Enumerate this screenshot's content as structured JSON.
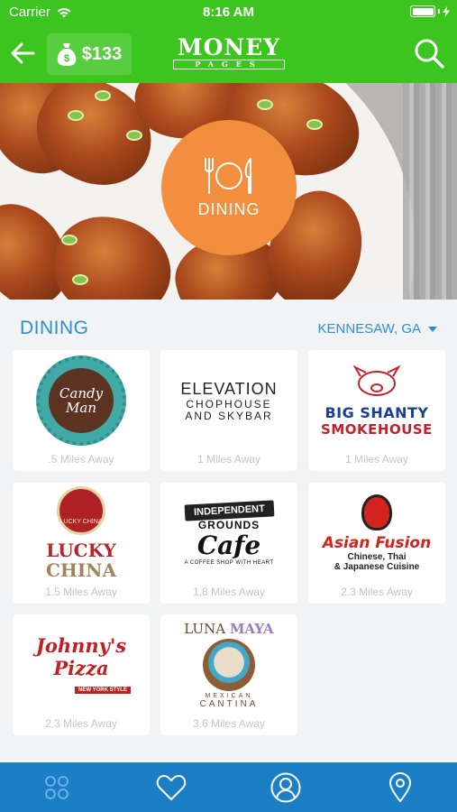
{
  "status_bar": {
    "carrier": "Carrier",
    "time": "8:16 AM",
    "battery_level": 1.0
  },
  "header": {
    "balance": "$133",
    "logo_line1": "MONEY",
    "logo_line2": "PAGES"
  },
  "hero": {
    "category_label": "DINING",
    "icon": "fork-plate-knife-icon"
  },
  "section": {
    "title": "DINING",
    "location": "KENNESAW, GA"
  },
  "listings": [
    {
      "logo_text": [
        "Candy",
        "Man"
      ],
      "distance": ".5 Miles Away"
    },
    {
      "logo_text": [
        "ELEVATION",
        "CHOPHOUSE",
        "AND SKYBAR"
      ],
      "distance": "1 Miles Away"
    },
    {
      "logo_text": [
        "BIG SHANTY",
        "SMOKEHOUSE"
      ],
      "distance": "1 Miles Away"
    },
    {
      "logo_text": [
        "LUCKY",
        "CHINA",
        "LUCKY CHINA"
      ],
      "distance": "1.5 Miles Away"
    },
    {
      "logo_text": [
        "INDEPENDENT",
        "GROUNDS",
        "Cafe",
        "A COFFEE SHOP WITH HEART"
      ],
      "distance": "1.8 Miles Away"
    },
    {
      "logo_text": [
        "Asian Fusion",
        "Chinese, Thai",
        "& Japanese Cuisine"
      ],
      "distance": "2.3 Miles Away"
    },
    {
      "logo_text": [
        "Johnny's Pizza",
        "NEW YORK STYLE"
      ],
      "distance": "2.3 Miles Away"
    },
    {
      "logo_text": [
        "LUNA",
        "MAYA",
        "MEXICAN",
        "CANTINA"
      ],
      "distance": "3.6 Miles Away"
    }
  ],
  "tabbar": {
    "items": [
      {
        "icon": "grid-icon",
        "active": true
      },
      {
        "icon": "heart-icon",
        "active": false
      },
      {
        "icon": "profile-icon",
        "active": false
      },
      {
        "icon": "map-pin-icon",
        "active": false
      }
    ]
  },
  "colors": {
    "header_green": "#3dc51f",
    "accent_blue": "#2a8fd0",
    "tabbar_blue": "#1a7fc4",
    "badge_orange": "#f28e3e"
  }
}
